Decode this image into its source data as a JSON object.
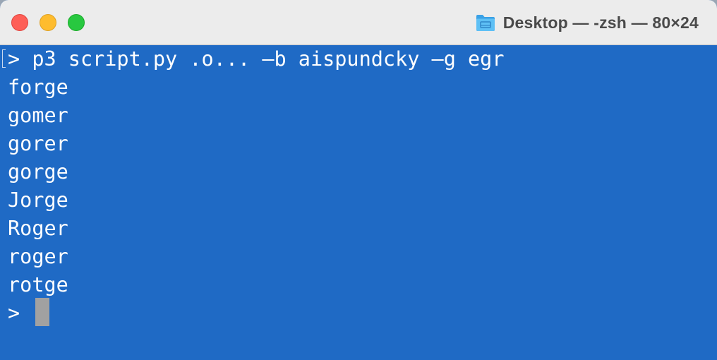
{
  "window": {
    "title": "Desktop — -zsh — 80×24",
    "title_icon": "folder-icon",
    "traffic_lights": [
      {
        "name": "close",
        "color": "#fe5f57"
      },
      {
        "name": "minimize",
        "color": "#febc2e"
      },
      {
        "name": "zoom",
        "color": "#28c840"
      }
    ]
  },
  "terminal": {
    "background": "#1f6ac5",
    "foreground": "#ffffff",
    "command_line": "> p3 script.py .o... –b aispundcky –g egr",
    "output": [
      "forge",
      "gomer",
      "gorer",
      "gorge",
      "Jorge",
      "Roger",
      "roger",
      "rotge"
    ],
    "prompt": ">",
    "cursor_color": "#a1a1a1"
  }
}
